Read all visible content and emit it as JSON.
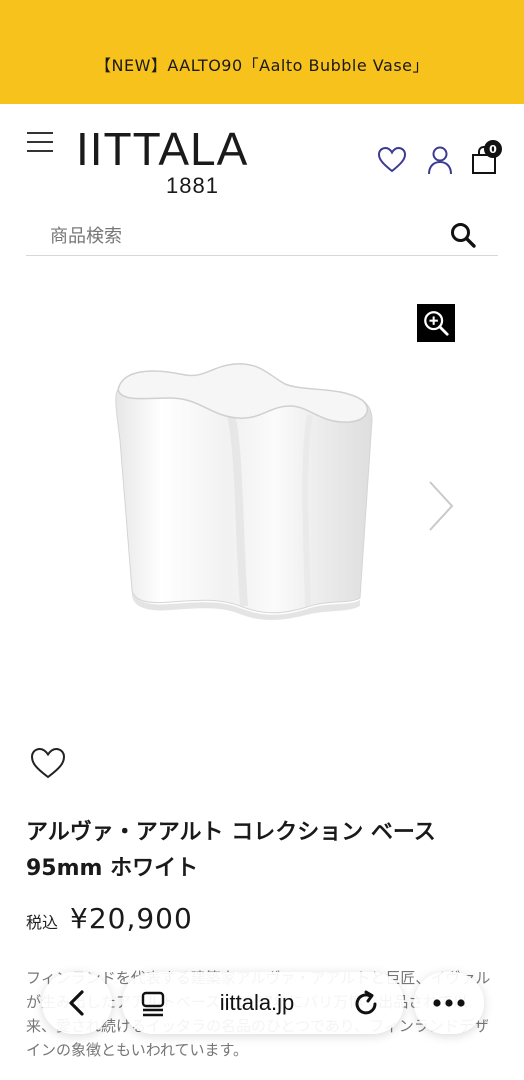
{
  "promo": {
    "text": "【NEW】AALTO90「Aalto Bubble Vase」"
  },
  "header": {
    "logo_name": "IITTALA",
    "logo_year": "1881",
    "cart_count": "0"
  },
  "search": {
    "placeholder": "商品検索"
  },
  "product": {
    "title": "アルヴァ・アアルト コレクション ベース 95mm ホワイト",
    "tax_label": "税込",
    "price": "¥20,900",
    "description": "フィンランドを代表する建築家アルヴァ・アアルトと巨匠、イヴァルが生み出したアアルトベースは1937年にパリ万博で出品されて以来、愛され続けるイッタラの名品のひとつであり、フィンランドデザインの象徴ともいわれています。"
  },
  "browser": {
    "url": "iittala.jp"
  },
  "colors": {
    "promo_bg": "#f7c21c",
    "heart_icon": "#3b3b8f",
    "text": "#1a1a1a"
  }
}
